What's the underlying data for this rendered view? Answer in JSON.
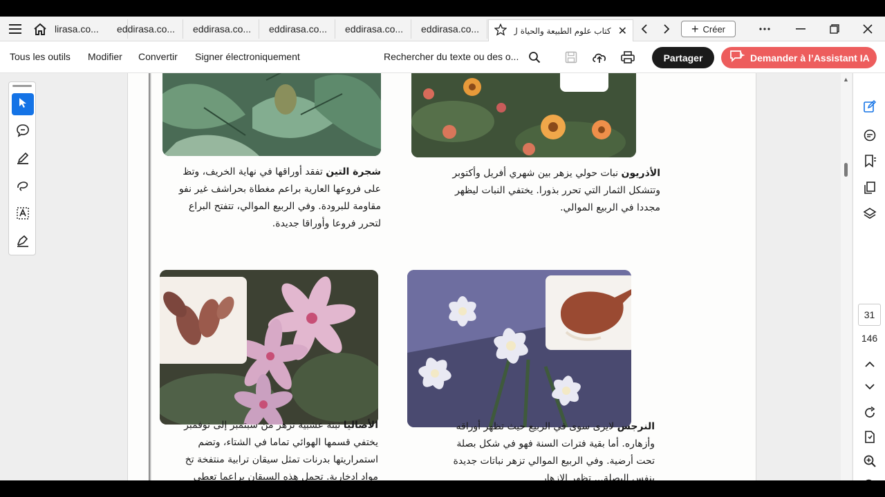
{
  "tabbar": {
    "tabs": [
      {
        "label": "lirasa.co..."
      },
      {
        "label": "eddirasa.co..."
      },
      {
        "label": "eddirasa.co..."
      },
      {
        "label": "eddirasa.co..."
      },
      {
        "label": "eddirasa.co..."
      },
      {
        "label": "eddirasa.co..."
      }
    ],
    "active_tab": {
      "label": "كتاب علوم الطبيعة والحياة ل..."
    },
    "create_label": "Créer"
  },
  "toolbar": {
    "all_tools": "Tous les outils",
    "edit": "Modifier",
    "convert": "Convertir",
    "sign": "Signer électroniquement",
    "search_placeholder": "Rechercher du texte ou des o...",
    "share": "Partager",
    "ai_assistant": "Demander à l’Assistant IA"
  },
  "document": {
    "fig": {
      "name": "شجرة التين",
      "lines": [
        "تفقد أوراقها في نهاية الخريف، وتظ",
        "على فروعها العارية براعم مغطاة بحراشف غير نفو",
        "مقاومة للبرودة. وفي الربيع الموالي، تتفتح البراع",
        "لتحرر فروعا وأوراقا جديدة."
      ]
    },
    "marigold": {
      "name": "الأذريون",
      "lines": [
        "نبات حولي يزهر بين شهري أفريل وأكتوبر",
        "وتتشكل الثمار التي تحرر بذورا. يختفي النبات ليظهر",
        "مجددا في الربيع الموالي."
      ]
    },
    "dahlia": {
      "name": "الأضاليا",
      "lines": [
        "نبتة عشبية تزهر من سبتمبر إلى نوفمبر",
        "يختفي قسمها الهوائي تماما في الشتاء، وتضم",
        "استمراريتها بدرنات تمثل سيقان ترابية منتفخة تخ",
        "مواد ادخارية. تحمل هذه السيقان براعما تعطي"
      ]
    },
    "narcissus": {
      "name": "النرجس",
      "lines": [
        "لايرى سوى في الربيع حيث تظهر أوراقه",
        "وأزهاره. أما بقية فترات السنة فهو في شكل بصلة",
        "تحت أرضية. وفي الربيع الموالي تزهر نباتات جديدة",
        "بنفس البصلة... تظهر الازهار"
      ]
    }
  },
  "pagination": {
    "current_page": "31",
    "total_pages": "146"
  },
  "colors": {
    "accent_blue": "#1473e6",
    "ai_red": "#ed5d5d",
    "share_dark": "#1b1b1b"
  }
}
